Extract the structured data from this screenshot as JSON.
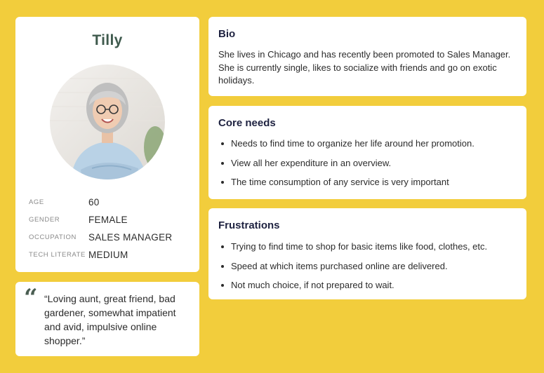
{
  "persona": {
    "name": "Tilly",
    "avatar_alt": "persona-photo",
    "stats": [
      {
        "label": "AGE",
        "value": "60"
      },
      {
        "label": "GENDER",
        "value": "FEMALE"
      },
      {
        "label": "OCCUPATION",
        "value": "SALES MANAGER"
      },
      {
        "label": "TECH LITERATE",
        "value": "MEDIUM"
      }
    ],
    "quote": "“Loving aunt, great friend, bad gardener, somewhat impatient and avid, impulsive online shopper.”"
  },
  "bio": {
    "title": "Bio",
    "text": "She lives in Chicago and has recently been promoted to Sales Manager.  She is currently single, likes to socialize with friends and go on exotic holidays."
  },
  "core_needs": {
    "title": "Core needs",
    "items": [
      "Needs to find time to organize her life around her promotion.",
      "View all her expenditure in an overview.",
      "The time consumption of any service is very important"
    ]
  },
  "frustrations": {
    "title": "Frustrations",
    "items": [
      "Trying to find time to shop for basic items like food, clothes, etc.",
      "Speed at which items purchased online are delivered.",
      "Not much choice, if not prepared to wait."
    ]
  },
  "colors": {
    "background": "#f2cd3c",
    "card": "#ffffff",
    "heading": "#1e2240",
    "name": "#3f5a4d"
  }
}
